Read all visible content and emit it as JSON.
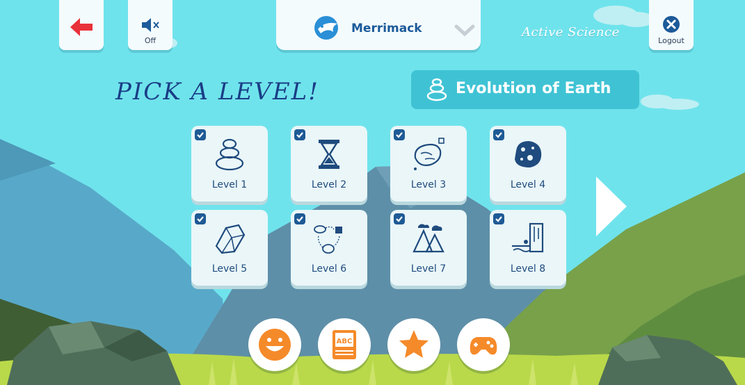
{
  "header": {
    "sound_label": "Off",
    "username": "Merrimack",
    "brand": "Active Science",
    "logout_label": "Logout"
  },
  "page": {
    "title": "PICK A LEVEL!",
    "topic": "Evolution of Earth"
  },
  "levels": [
    {
      "label": "Level 1",
      "icon": "stacked-stones-icon",
      "completed": true
    },
    {
      "label": "Level 2",
      "icon": "hourglass-icon",
      "completed": true
    },
    {
      "label": "Level 3",
      "icon": "meteor-rock-icon",
      "completed": true
    },
    {
      "label": "Level 4",
      "icon": "asteroid-icon",
      "completed": true
    },
    {
      "label": "Level 5",
      "icon": "crystal-icon",
      "completed": true
    },
    {
      "label": "Level 6",
      "icon": "rock-cycle-icon",
      "completed": true
    },
    {
      "label": "Level 7",
      "icon": "mountains-icon",
      "completed": true
    },
    {
      "label": "Level 8",
      "icon": "waterfall-cliff-icon",
      "completed": true
    }
  ],
  "bottom_nav": [
    {
      "icon": "smiley-icon"
    },
    {
      "icon": "abc-book-icon"
    },
    {
      "icon": "star-icon"
    },
    {
      "icon": "gamepad-icon"
    }
  ],
  "colors": {
    "sky": "#6fe3ec",
    "accent_orange": "#f58a2a",
    "title_blue": "#1a3d86",
    "badge_teal": "#3fc3d4",
    "back_arrow_red": "#e8313a"
  }
}
